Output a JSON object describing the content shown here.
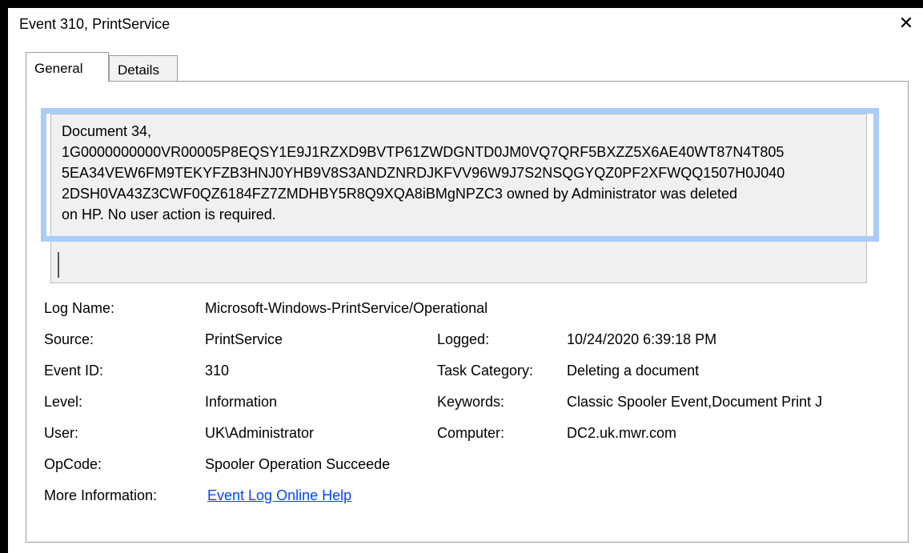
{
  "window": {
    "title": "Event 310, PrintService",
    "close_glyph": "✕"
  },
  "tabs": [
    {
      "label": "General",
      "active": true
    },
    {
      "label": "Details",
      "active": false
    }
  ],
  "description": "Document 34,\n1G0000000000VR00005P8EQSY1E9J1RZXD9BVTP61ZWDGNTD0JM0VQ7QRF5BXZZ5X6AE40WT87N4T805\n5EA34VEW6FM9TEKYFZB3HNJ0YHB9V8S3ANDZNRDJKFVV96W9J7S2NSQGYQZ0PF2XFWQQ1507H0J040\n2DSH0VA43Z3CWF0QZ6184FZ7ZMDHBY5R8Q9XQA8iBMgNPZC3 owned by Administrator was deleted\non HP. No user action is required.",
  "fields": {
    "log_name": {
      "label": "Log Name:",
      "value": "Microsoft-Windows-PrintService/Operational"
    },
    "source": {
      "label": "Source:",
      "value": "PrintService"
    },
    "logged": {
      "label": "Logged:",
      "value": "10/24/2020 6:39:18 PM"
    },
    "event_id": {
      "label": "Event ID:",
      "value": "310"
    },
    "task_category": {
      "label": "Task Category:",
      "value": "Deleting a document"
    },
    "level": {
      "label": "Level:",
      "value": "Information"
    },
    "keywords": {
      "label": "Keywords:",
      "value": "Classic Spooler Event,Document Print J"
    },
    "user": {
      "label": "User:",
      "value": "UK\\Administrator"
    },
    "computer": {
      "label": "Computer:",
      "value": "DC2.uk.mwr.com"
    },
    "opcode": {
      "label": "OpCode:",
      "value": "Spooler Operation Succeede"
    },
    "more_info": {
      "label": "More Information:",
      "value": "Event Log Online Help"
    }
  },
  "colors": {
    "highlight": "#a9cdf7",
    "link": "#0645ff"
  },
  "icons": {
    "close": "close-icon"
  }
}
